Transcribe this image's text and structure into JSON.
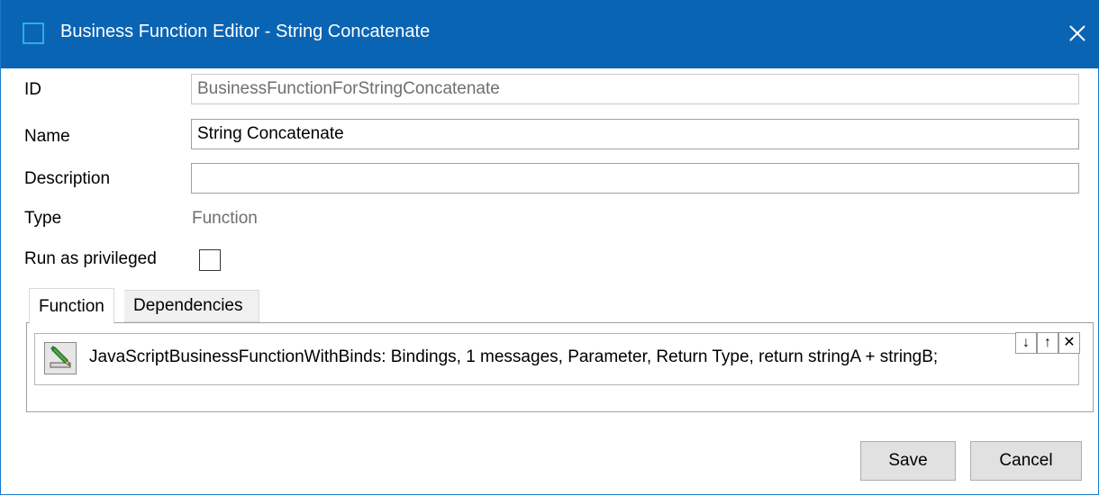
{
  "window": {
    "title": "Business Function Editor - String Concatenate"
  },
  "form": {
    "id": {
      "label": "ID",
      "value": "BusinessFunctionForStringConcatenate"
    },
    "name": {
      "label": "Name",
      "value": "String Concatenate"
    },
    "description": {
      "label": "Description",
      "value": ""
    },
    "type": {
      "label": "Type",
      "value": "Function"
    },
    "run_as_privileged": {
      "label": "Run as privileged",
      "checked": false
    }
  },
  "tabs": [
    {
      "label": "Function",
      "active": true
    },
    {
      "label": "Dependencies",
      "active": false
    }
  ],
  "function_entry": {
    "text": "JavaScriptBusinessFunctionWithBinds: Bindings, 1 messages, Parameter, Return Type, return stringA + stringB;",
    "controls": {
      "move_down": "↓",
      "move_up": "↑",
      "remove": "✕"
    }
  },
  "buttons": {
    "save": "Save",
    "cancel": "Cancel"
  },
  "colors": {
    "titlebar": "#0a64b4",
    "accent": "#29b0e0"
  },
  "icons": [
    "app-icon",
    "close-icon",
    "edit-pencil-icon"
  ]
}
